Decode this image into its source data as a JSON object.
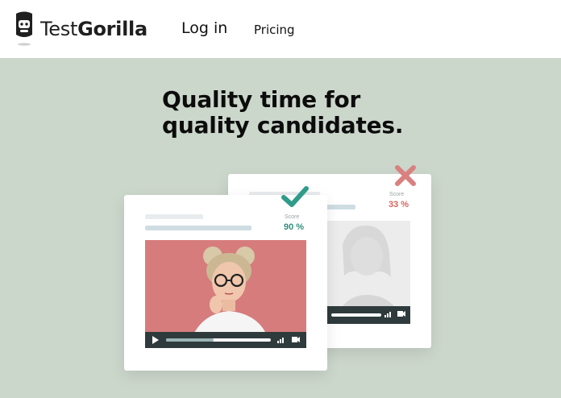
{
  "header": {
    "logo": {
      "text_light": "Test",
      "text_bold": "Gorilla",
      "icon": "gorilla-logo-icon"
    },
    "nav": {
      "login_label": "Log in",
      "pricing_label": "Pricing"
    }
  },
  "hero": {
    "title_line1": "Quality time for",
    "title_line2": "quality candidates.",
    "background": "#ccd7cc"
  },
  "cards": {
    "back": {
      "status_icon": "cross-icon",
      "score_label": "Score",
      "score_value": "33 %",
      "score_color": "#d9635e"
    },
    "front": {
      "status_icon": "checkmark-icon",
      "score_label": "Score",
      "score_value": "90 %",
      "score_color": "#2f8f7f",
      "video_progress": 0.45
    }
  },
  "colors": {
    "check": "#2f9c8a",
    "cross": "#d98080",
    "controls": "#2e3a3c"
  }
}
